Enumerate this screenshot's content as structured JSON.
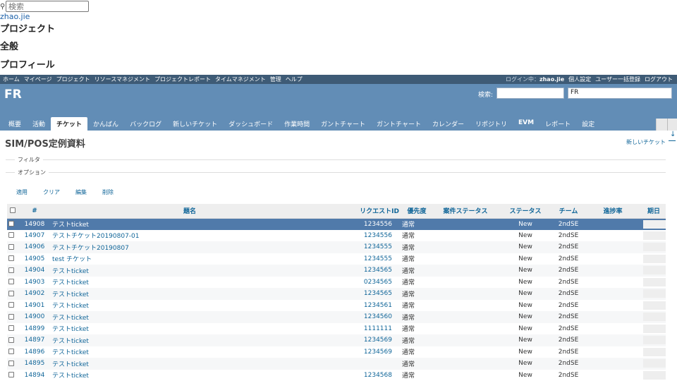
{
  "raw_header": {
    "search_placeholder": "検索",
    "user": "zhao.jie",
    "headings": [
      "プロジェクト",
      "全般",
      "プロフィール"
    ]
  },
  "top_menu": {
    "items": [
      "ホーム",
      "マイページ",
      "プロジェクト",
      "リソースマネジメント",
      "プロジェクトレポート",
      "タイムマネジメント",
      "管理",
      "ヘルプ"
    ],
    "login_label": "ログイン中：",
    "login_user": "zhao.jie",
    "right_items": [
      "個人設定",
      "ユーザー一括登録",
      "ログアウト"
    ]
  },
  "header": {
    "project_title": "FR",
    "search_label": "検索:",
    "search_value": "",
    "project_select_value": "FR"
  },
  "tabs": [
    "概要",
    "活動",
    "チケット",
    "かんばん",
    "バックログ",
    "新しいチケット",
    "ダッシュボード",
    "作業時間",
    "ガントチャート",
    "ガントチャート",
    "カレンダー",
    "リポジトリ",
    "EVM",
    "レポート",
    "設定"
  ],
  "content": {
    "page_title": "SIM/POS定例資料",
    "new_issue_link": "新しいチケット",
    "filter_legend": "フィルタ",
    "options_legend": "オプション",
    "actions": [
      "適用",
      "クリア",
      "編集",
      "削除"
    ]
  },
  "table": {
    "headers": [
      "#",
      "題名",
      "リクエストID",
      "優先度",
      "案件ステータス",
      "ステータス",
      "チーム",
      "進捗率",
      "期日"
    ],
    "rows": [
      {
        "id": "14908",
        "subject": "テストticket",
        "request_id": "1234556",
        "priority": "通常",
        "case_status": "",
        "status": "New",
        "team": "2ndSE",
        "progress": 0,
        "due": ""
      },
      {
        "id": "14907",
        "subject": "テストチケット20190807-01",
        "request_id": "1234556",
        "priority": "通常",
        "case_status": "",
        "status": "New",
        "team": "2ndSE",
        "progress": 0,
        "due": ""
      },
      {
        "id": "14906",
        "subject": "テストチケット20190807",
        "request_id": "1234555",
        "priority": "通常",
        "case_status": "",
        "status": "New",
        "team": "2ndSE",
        "progress": 0,
        "due": ""
      },
      {
        "id": "14905",
        "subject": "test チケット",
        "request_id": "1234555",
        "priority": "通常",
        "case_status": "",
        "status": "New",
        "team": "2ndSE",
        "progress": 0,
        "due": ""
      },
      {
        "id": "14904",
        "subject": "テストticket",
        "request_id": "1234565",
        "priority": "通常",
        "case_status": "",
        "status": "New",
        "team": "2ndSE",
        "progress": 0,
        "due": ""
      },
      {
        "id": "14903",
        "subject": "テストticket",
        "request_id": "0234565",
        "priority": "通常",
        "case_status": "",
        "status": "New",
        "team": "2ndSE",
        "progress": 0,
        "due": ""
      },
      {
        "id": "14902",
        "subject": "テストticket",
        "request_id": "1234565",
        "priority": "通常",
        "case_status": "",
        "status": "New",
        "team": "2ndSE",
        "progress": 0,
        "due": ""
      },
      {
        "id": "14901",
        "subject": "テストticket",
        "request_id": "1234561",
        "priority": "通常",
        "case_status": "",
        "status": "New",
        "team": "2ndSE",
        "progress": 0,
        "due": ""
      },
      {
        "id": "14900",
        "subject": "テストticket",
        "request_id": "1234560",
        "priority": "通常",
        "case_status": "",
        "status": "New",
        "team": "2ndSE",
        "progress": 0,
        "due": ""
      },
      {
        "id": "14899",
        "subject": "テストticket",
        "request_id": "1111111",
        "priority": "通常",
        "case_status": "",
        "status": "New",
        "team": "2ndSE",
        "progress": 0,
        "due": ""
      },
      {
        "id": "14897",
        "subject": "テストticket",
        "request_id": "1234569",
        "priority": "通常",
        "case_status": "",
        "status": "New",
        "team": "2ndSE",
        "progress": 0,
        "due": ""
      },
      {
        "id": "14896",
        "subject": "テストticket",
        "request_id": "1234569",
        "priority": "通常",
        "case_status": "",
        "status": "New",
        "team": "2ndSE",
        "progress": 0,
        "due": ""
      },
      {
        "id": "14895",
        "subject": "テストticket",
        "request_id": "",
        "priority": "通常",
        "case_status": "",
        "status": "New",
        "team": "2ndSE",
        "progress": 0,
        "due": ""
      },
      {
        "id": "14894",
        "subject": "テストticket",
        "request_id": "1234568",
        "priority": "通常",
        "case_status": "",
        "status": "New",
        "team": "2ndSE",
        "progress": 0,
        "due": ""
      }
    ],
    "selected_row_index": 0
  },
  "colors": {
    "top_menu_bg": "#3e5b76",
    "header_bg": "#628db6",
    "link": "#169",
    "selected_row": "#507aaa"
  }
}
